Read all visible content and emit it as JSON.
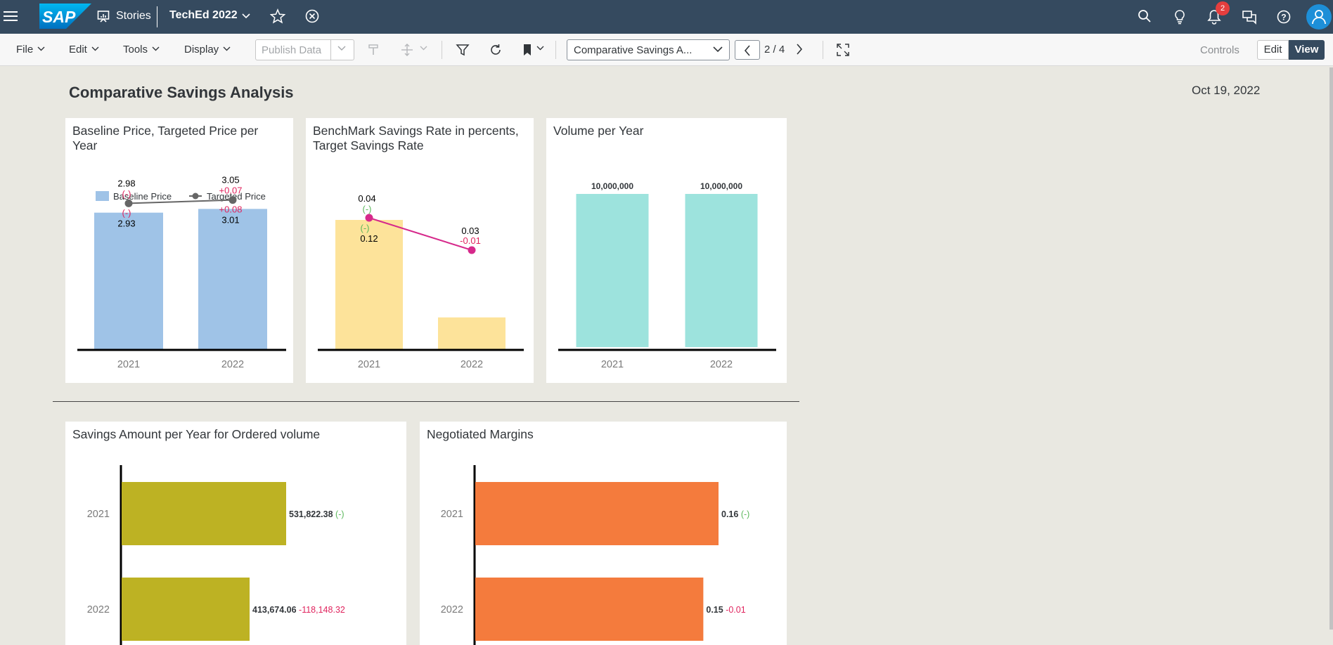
{
  "shell": {
    "app_label": "Stories",
    "story_title": "TechEd 2022",
    "notification_count": "2",
    "logo_text": "SAP"
  },
  "toolbar": {
    "menus": [
      "File",
      "Edit",
      "Tools",
      "Display"
    ],
    "publish_label": "Publish Data",
    "page_select": "Comparative Savings A...",
    "page_count": "2 / 4",
    "controls_label": "Controls",
    "edit_label": "Edit",
    "view_label": "View"
  },
  "page": {
    "title": "Comparative Savings Analysis",
    "date": "Oct 19, 2022"
  },
  "chart_data": [
    {
      "type": "bar",
      "title": "Baseline Price, Targeted Price per Year",
      "categories": [
        "2021",
        "2022"
      ],
      "series": [
        {
          "name": "Baseline Price",
          "kind": "bar",
          "color": "#9fc3e7",
          "values": [
            2.93,
            3.01
          ],
          "labels": [
            "2.93",
            "3.01"
          ],
          "variance": [
            "(-)",
            "+0.08"
          ]
        },
        {
          "name": "Targeted Price",
          "kind": "line",
          "color": "#666666",
          "values": [
            2.98,
            3.05
          ],
          "labels": [
            "2.98",
            "3.05"
          ],
          "variance": [
            "(-)",
            "+0.07"
          ]
        }
      ],
      "legend": "top"
    },
    {
      "type": "bar",
      "title": "BenchMark Savings Rate in percents, Target Savings Rate",
      "categories": [
        "2021",
        "2022"
      ],
      "series": [
        {
          "kind": "bar",
          "color": "#fde39a",
          "values": [
            0.12,
            0.03
          ],
          "labels": [
            "0.12",
            "0.03"
          ],
          "variance": [
            "(-)",
            "-0.01"
          ]
        },
        {
          "kind": "line",
          "color": "#d6298b",
          "values": [
            0.04,
            0.03
          ],
          "labels": [
            "0.04",
            ""
          ],
          "variance": [
            "(-)",
            "-0.01"
          ]
        }
      ]
    },
    {
      "type": "bar",
      "title": "Volume per Year",
      "categories": [
        "2021",
        "2022"
      ],
      "series": [
        {
          "color": "#9de3dd",
          "values": [
            10000000,
            10000000
          ],
          "labels": [
            "10,000,000",
            "10,000,000"
          ]
        }
      ]
    },
    {
      "type": "bar",
      "orientation": "horizontal",
      "title": "Savings Amount per Year for Ordered volume",
      "categories": [
        "2021",
        "2022"
      ],
      "series": [
        {
          "color": "#bdb223",
          "values": [
            531822.38,
            413674.06
          ],
          "labels": [
            "531,822.38",
            "413,674.06"
          ],
          "variance": [
            "(-)",
            "-118,148.32"
          ]
        }
      ]
    },
    {
      "type": "bar",
      "orientation": "horizontal",
      "title": "Negotiated Margins",
      "categories": [
        "2021",
        "2022"
      ],
      "series": [
        {
          "color": "#f47b3d",
          "values": [
            0.16,
            0.15
          ],
          "labels": [
            "0.16",
            "0.15"
          ],
          "variance": [
            "(-)",
            "-0.01"
          ]
        }
      ]
    }
  ],
  "colors": {
    "shell": "#354a5f",
    "variance_neutral": "#5cb85c",
    "variance_negative": "#e0245e"
  }
}
